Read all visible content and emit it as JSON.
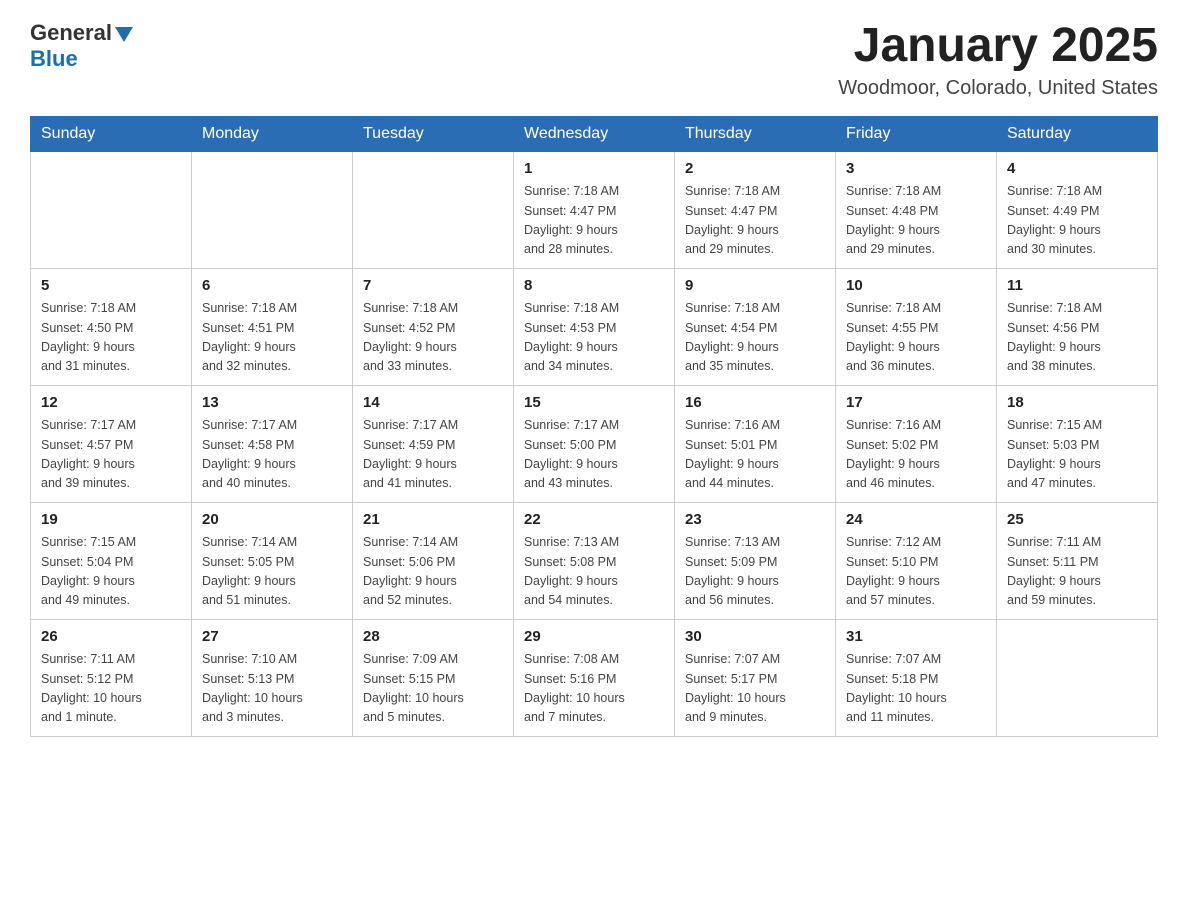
{
  "header": {
    "logo": {
      "general": "General",
      "blue": "Blue"
    },
    "title": "January 2025",
    "location": "Woodmoor, Colorado, United States"
  },
  "calendar": {
    "days_of_week": [
      "Sunday",
      "Monday",
      "Tuesday",
      "Wednesday",
      "Thursday",
      "Friday",
      "Saturday"
    ],
    "weeks": [
      [
        {
          "day": "",
          "info": ""
        },
        {
          "day": "",
          "info": ""
        },
        {
          "day": "",
          "info": ""
        },
        {
          "day": "1",
          "info": "Sunrise: 7:18 AM\nSunset: 4:47 PM\nDaylight: 9 hours\nand 28 minutes."
        },
        {
          "day": "2",
          "info": "Sunrise: 7:18 AM\nSunset: 4:47 PM\nDaylight: 9 hours\nand 29 minutes."
        },
        {
          "day": "3",
          "info": "Sunrise: 7:18 AM\nSunset: 4:48 PM\nDaylight: 9 hours\nand 29 minutes."
        },
        {
          "day": "4",
          "info": "Sunrise: 7:18 AM\nSunset: 4:49 PM\nDaylight: 9 hours\nand 30 minutes."
        }
      ],
      [
        {
          "day": "5",
          "info": "Sunrise: 7:18 AM\nSunset: 4:50 PM\nDaylight: 9 hours\nand 31 minutes."
        },
        {
          "day": "6",
          "info": "Sunrise: 7:18 AM\nSunset: 4:51 PM\nDaylight: 9 hours\nand 32 minutes."
        },
        {
          "day": "7",
          "info": "Sunrise: 7:18 AM\nSunset: 4:52 PM\nDaylight: 9 hours\nand 33 minutes."
        },
        {
          "day": "8",
          "info": "Sunrise: 7:18 AM\nSunset: 4:53 PM\nDaylight: 9 hours\nand 34 minutes."
        },
        {
          "day": "9",
          "info": "Sunrise: 7:18 AM\nSunset: 4:54 PM\nDaylight: 9 hours\nand 35 minutes."
        },
        {
          "day": "10",
          "info": "Sunrise: 7:18 AM\nSunset: 4:55 PM\nDaylight: 9 hours\nand 36 minutes."
        },
        {
          "day": "11",
          "info": "Sunrise: 7:18 AM\nSunset: 4:56 PM\nDaylight: 9 hours\nand 38 minutes."
        }
      ],
      [
        {
          "day": "12",
          "info": "Sunrise: 7:17 AM\nSunset: 4:57 PM\nDaylight: 9 hours\nand 39 minutes."
        },
        {
          "day": "13",
          "info": "Sunrise: 7:17 AM\nSunset: 4:58 PM\nDaylight: 9 hours\nand 40 minutes."
        },
        {
          "day": "14",
          "info": "Sunrise: 7:17 AM\nSunset: 4:59 PM\nDaylight: 9 hours\nand 41 minutes."
        },
        {
          "day": "15",
          "info": "Sunrise: 7:17 AM\nSunset: 5:00 PM\nDaylight: 9 hours\nand 43 minutes."
        },
        {
          "day": "16",
          "info": "Sunrise: 7:16 AM\nSunset: 5:01 PM\nDaylight: 9 hours\nand 44 minutes."
        },
        {
          "day": "17",
          "info": "Sunrise: 7:16 AM\nSunset: 5:02 PM\nDaylight: 9 hours\nand 46 minutes."
        },
        {
          "day": "18",
          "info": "Sunrise: 7:15 AM\nSunset: 5:03 PM\nDaylight: 9 hours\nand 47 minutes."
        }
      ],
      [
        {
          "day": "19",
          "info": "Sunrise: 7:15 AM\nSunset: 5:04 PM\nDaylight: 9 hours\nand 49 minutes."
        },
        {
          "day": "20",
          "info": "Sunrise: 7:14 AM\nSunset: 5:05 PM\nDaylight: 9 hours\nand 51 minutes."
        },
        {
          "day": "21",
          "info": "Sunrise: 7:14 AM\nSunset: 5:06 PM\nDaylight: 9 hours\nand 52 minutes."
        },
        {
          "day": "22",
          "info": "Sunrise: 7:13 AM\nSunset: 5:08 PM\nDaylight: 9 hours\nand 54 minutes."
        },
        {
          "day": "23",
          "info": "Sunrise: 7:13 AM\nSunset: 5:09 PM\nDaylight: 9 hours\nand 56 minutes."
        },
        {
          "day": "24",
          "info": "Sunrise: 7:12 AM\nSunset: 5:10 PM\nDaylight: 9 hours\nand 57 minutes."
        },
        {
          "day": "25",
          "info": "Sunrise: 7:11 AM\nSunset: 5:11 PM\nDaylight: 9 hours\nand 59 minutes."
        }
      ],
      [
        {
          "day": "26",
          "info": "Sunrise: 7:11 AM\nSunset: 5:12 PM\nDaylight: 10 hours\nand 1 minute."
        },
        {
          "day": "27",
          "info": "Sunrise: 7:10 AM\nSunset: 5:13 PM\nDaylight: 10 hours\nand 3 minutes."
        },
        {
          "day": "28",
          "info": "Sunrise: 7:09 AM\nSunset: 5:15 PM\nDaylight: 10 hours\nand 5 minutes."
        },
        {
          "day": "29",
          "info": "Sunrise: 7:08 AM\nSunset: 5:16 PM\nDaylight: 10 hours\nand 7 minutes."
        },
        {
          "day": "30",
          "info": "Sunrise: 7:07 AM\nSunset: 5:17 PM\nDaylight: 10 hours\nand 9 minutes."
        },
        {
          "day": "31",
          "info": "Sunrise: 7:07 AM\nSunset: 5:18 PM\nDaylight: 10 hours\nand 11 minutes."
        },
        {
          "day": "",
          "info": ""
        }
      ]
    ]
  }
}
